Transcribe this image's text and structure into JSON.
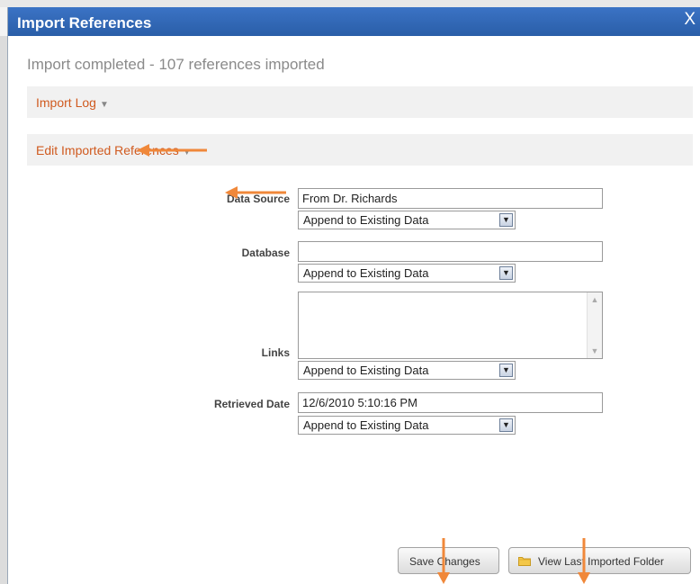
{
  "dialog": {
    "title": "Import References",
    "close_label": "X",
    "status": "Import completed - 107 references imported",
    "import_log_label": "Import Log",
    "edit_refs_label": "Edit Imported References"
  },
  "form": {
    "data_source": {
      "label": "Data Source",
      "value": "From Dr. Richards",
      "mode": "Append to Existing Data"
    },
    "database": {
      "label": "Database",
      "value": "",
      "mode": "Append to Existing Data"
    },
    "links": {
      "label": "Links",
      "value": "",
      "mode": "Append to Existing Data"
    },
    "retrieved_date": {
      "label": "Retrieved Date",
      "value": "12/6/2010 5:10:16 PM",
      "mode": "Append to Existing Data"
    }
  },
  "buttons": {
    "save": "Save Changes",
    "view_folder": "View Last Imported Folder"
  },
  "colors": {
    "titlebar": "#2f66b3",
    "link": "#d05a1f",
    "annotation_arrow": "#f0883a"
  },
  "icons": {
    "close": "close-icon",
    "caret": "caret-down-icon",
    "folder": "folder-icon"
  }
}
